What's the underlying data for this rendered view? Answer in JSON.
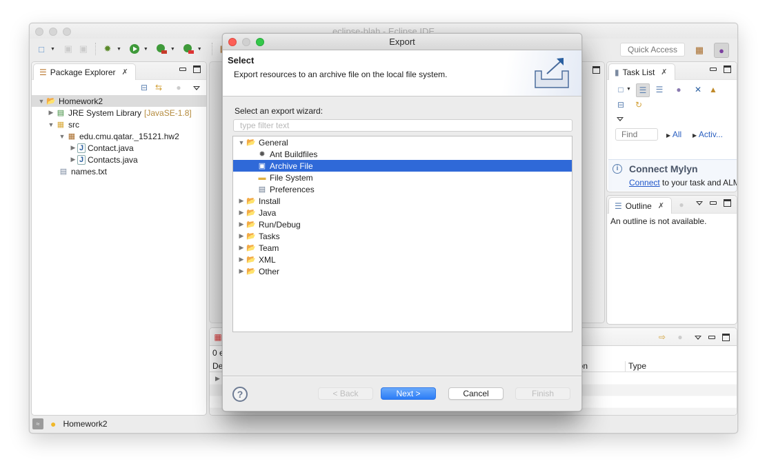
{
  "ide": {
    "title": "eclipse-blah - Eclipse IDE",
    "quick_access_placeholder": "Quick Access",
    "toolbar_icons": [
      "new-icon",
      "save-icon",
      "save-all-icon",
      "debug-icon",
      "run-icon",
      "coverage-icon",
      "external-tools-icon",
      "new-package-icon",
      "new-class-icon",
      "open-folder-icon"
    ]
  },
  "package_explorer": {
    "tab_label": "Package Explorer",
    "tree": [
      {
        "label": "Homework2",
        "expanded": true,
        "icon": "project-icon"
      },
      {
        "label": "JRE System Library",
        "decoration": "[JavaSE-1.8]",
        "expanded": false,
        "icon": "library-icon"
      },
      {
        "label": "src",
        "expanded": true,
        "icon": "source-folder-icon"
      },
      {
        "label": "edu.cmu.qatar._15121.hw2",
        "expanded": true,
        "icon": "package-icon"
      },
      {
        "label": "Contact.java",
        "expanded": false,
        "icon": "java-file-icon"
      },
      {
        "label": "Contacts.java",
        "expanded": false,
        "icon": "java-file-icon"
      },
      {
        "label": "names.txt",
        "icon": "text-file-icon"
      }
    ]
  },
  "task_list": {
    "tab_label": "Task List",
    "find_placeholder": "Find",
    "filter_all": "All",
    "filter_active": "Activ...",
    "mylyn_title": "Connect Mylyn",
    "mylyn_link": "Connect",
    "mylyn_text": " to your task and ALM"
  },
  "outline": {
    "tab_label": "Outline",
    "message": "An outline is not available."
  },
  "problems": {
    "summary": "0 e",
    "col_description": "De",
    "col_location": "ion",
    "col_type": "Type"
  },
  "status_bar": {
    "text": "Homework2"
  },
  "dialog": {
    "title": "Export",
    "header_title": "Select",
    "header_description": "Export resources to an archive file on the local file system.",
    "wizard_label": "Select an export wizard:",
    "filter_placeholder": "type filter text",
    "filter_value": "",
    "tree": [
      {
        "label": "General",
        "level": 0,
        "expanded": true,
        "icon": "folder-open-icon"
      },
      {
        "label": "Ant Buildfiles",
        "level": 1,
        "icon": "ant-icon"
      },
      {
        "label": "Archive File",
        "level": 1,
        "icon": "archive-icon",
        "selected": true
      },
      {
        "label": "File System",
        "level": 1,
        "icon": "folder-icon"
      },
      {
        "label": "Preferences",
        "level": 1,
        "icon": "preferences-icon"
      },
      {
        "label": "Install",
        "level": 0,
        "expanded": false,
        "icon": "folder-open-icon"
      },
      {
        "label": "Java",
        "level": 0,
        "expanded": false,
        "icon": "folder-open-icon"
      },
      {
        "label": "Run/Debug",
        "level": 0,
        "expanded": false,
        "icon": "folder-open-icon"
      },
      {
        "label": "Tasks",
        "level": 0,
        "expanded": false,
        "icon": "folder-open-icon"
      },
      {
        "label": "Team",
        "level": 0,
        "expanded": false,
        "icon": "folder-open-icon"
      },
      {
        "label": "XML",
        "level": 0,
        "expanded": false,
        "icon": "folder-open-icon"
      },
      {
        "label": "Other",
        "level": 0,
        "expanded": false,
        "icon": "folder-open-icon"
      }
    ],
    "buttons": {
      "back": "< Back",
      "next": "Next >",
      "cancel": "Cancel",
      "finish": "Finish"
    },
    "colors": {
      "selection": "#2f69d8",
      "primary_button": "#2b7cf6",
      "close": "#fc5f57",
      "zoom": "#34c84a"
    }
  }
}
